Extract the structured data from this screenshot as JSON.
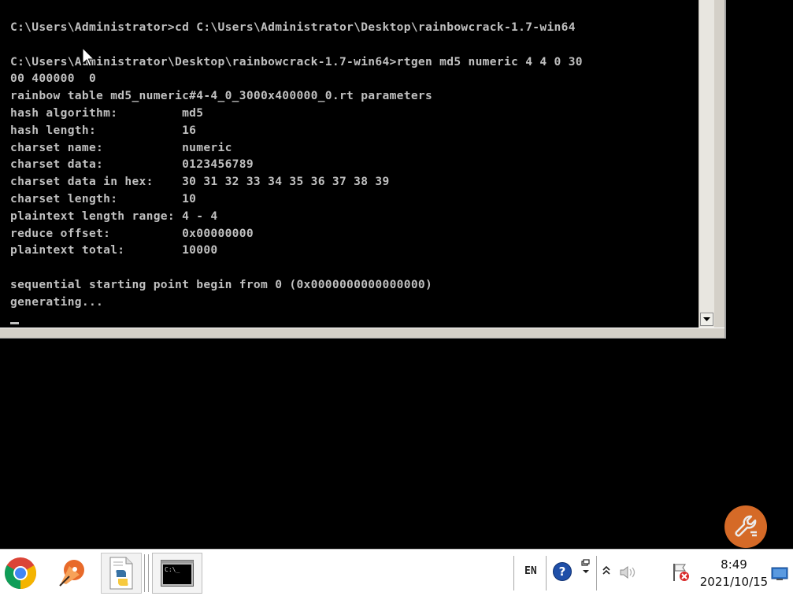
{
  "console": {
    "lines": [
      "C:\\Users\\Administrator>cd C:\\Users\\Administrator\\Desktop\\rainbowcrack-1.7-win64",
      "",
      "C:\\Users\\Administrator\\Desktop\\rainbowcrack-1.7-win64>rtgen md5 numeric 4 4 0 30",
      "00 400000  0",
      "rainbow table md5_numeric#4-4_0_3000x400000_0.rt parameters",
      "hash algorithm:         md5",
      "hash length:            16",
      "charset name:           numeric",
      "charset data:           0123456789",
      "charset data in hex:    30 31 32 33 34 35 36 37 38 39",
      "charset length:         10",
      "plaintext length range: 4 - 4",
      "reduce offset:          0x00000000",
      "plaintext total:        10000",
      "",
      "sequential starting point begin from 0 (0x0000000000000000)",
      "generating..."
    ]
  },
  "taskbar": {
    "pinned": [
      {
        "icon": "chrome-icon"
      },
      {
        "icon": "pen-tool-icon"
      },
      {
        "icon": "python-file-icon"
      }
    ],
    "cmd_task_label": "C:\\_"
  },
  "tray": {
    "language": "EN",
    "help_glyph": "?",
    "time": "8:49",
    "date": "2021/10/15"
  },
  "colors": {
    "console_bg": "#000000",
    "console_fg": "#c0c0c0",
    "tools_button": "#e8742b",
    "taskbar_bg": "#ffffff"
  }
}
